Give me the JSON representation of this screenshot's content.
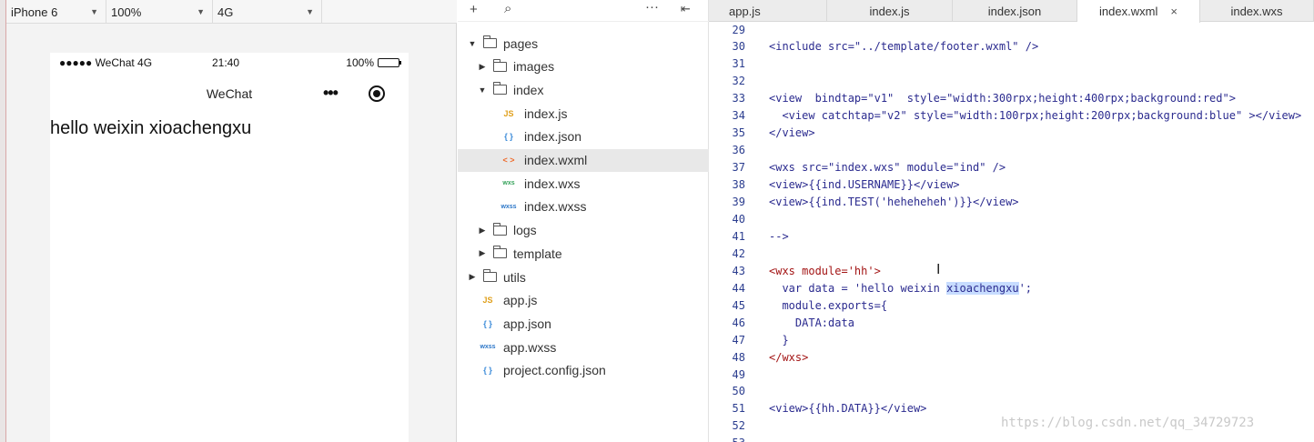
{
  "simulator": {
    "device": "iPhone 6",
    "zoom": "100%",
    "network": "4G",
    "status": {
      "carrier": "●●●●● WeChat 4G",
      "time": "21:40",
      "battery": "100%",
      "battery_level": 1.0
    },
    "nav_title": "WeChat",
    "nav_more": "•••",
    "page_text": "hello weixin xioachengxu"
  },
  "explorer": {
    "tree": [
      {
        "label": "pages",
        "type": "folder",
        "expanded": true,
        "depth": 0
      },
      {
        "label": "images",
        "type": "folder",
        "expanded": false,
        "depth": 1
      },
      {
        "label": "index",
        "type": "folder",
        "expanded": true,
        "depth": 1
      },
      {
        "label": "index.js",
        "type": "js",
        "icon_text": "JS",
        "depth": 2
      },
      {
        "label": "index.json",
        "type": "json",
        "icon_text": "{ }",
        "depth": 2
      },
      {
        "label": "index.wxml",
        "type": "wxml",
        "icon_text": "< >",
        "depth": 2,
        "selected": true
      },
      {
        "label": "index.wxs",
        "type": "wxs",
        "icon_text": "wxs",
        "depth": 2
      },
      {
        "label": "index.wxss",
        "type": "wxss",
        "icon_text": "wxss",
        "depth": 2
      },
      {
        "label": "logs",
        "type": "folder",
        "expanded": false,
        "depth": 1
      },
      {
        "label": "template",
        "type": "folder",
        "expanded": false,
        "depth": 1
      },
      {
        "label": "utils",
        "type": "folder",
        "expanded": false,
        "depth": 0
      },
      {
        "label": "app.js",
        "type": "js",
        "icon_text": "JS",
        "depth": 0
      },
      {
        "label": "app.json",
        "type": "json",
        "icon_text": "{ }",
        "depth": 0
      },
      {
        "label": "app.wxss",
        "type": "wxss",
        "icon_text": "wxss",
        "depth": 0
      },
      {
        "label": "project.config.json",
        "type": "json",
        "icon_text": "{ }",
        "depth": 0
      }
    ]
  },
  "editor": {
    "tabs": [
      {
        "label": "app.js",
        "active": false
      },
      {
        "label": "index.js",
        "active": false
      },
      {
        "label": "index.json",
        "active": false
      },
      {
        "label": "index.wxml",
        "active": true,
        "close": "×"
      },
      {
        "label": "index.wxs",
        "active": false
      }
    ],
    "lines": [
      {
        "n": "29",
        "text": ""
      },
      {
        "n": "30",
        "text": "<include src=\"../template/footer.wxml\" />"
      },
      {
        "n": "31",
        "text": ""
      },
      {
        "n": "32",
        "text": ""
      },
      {
        "n": "33",
        "text": "<view  bindtap=\"v1\"  style=\"width:300rpx;height:400rpx;background:red\">"
      },
      {
        "n": "34",
        "text": "  <view catchtap=\"v2\" style=\"width:100rpx;height:200rpx;background:blue\" ></view>"
      },
      {
        "n": "35",
        "text": "</view>"
      },
      {
        "n": "36",
        "text": ""
      },
      {
        "n": "37",
        "text": "<wxs src=\"index.wxs\" module=\"ind\" />"
      },
      {
        "n": "38",
        "text": "<view>{{ind.USERNAME}}</view>"
      },
      {
        "n": "39",
        "text": "<view>{{ind.TEST('heheheheh')}}</view>"
      },
      {
        "n": "40",
        "text": ""
      },
      {
        "n": "41",
        "text": "-->"
      },
      {
        "n": "42",
        "text": ""
      },
      {
        "n": "43",
        "text": "<wxs module='hh'>",
        "wxs": true
      },
      {
        "n": "44",
        "pre": "  var data = 'hello weixin ",
        "hl": "xioachengxu",
        "post": "';"
      },
      {
        "n": "45",
        "text": "  module.exports={"
      },
      {
        "n": "46",
        "text": "    DATA:data"
      },
      {
        "n": "47",
        "text": "  }"
      },
      {
        "n": "48",
        "text": "</wxs>",
        "wxs": true
      },
      {
        "n": "49",
        "text": ""
      },
      {
        "n": "50",
        "text": ""
      },
      {
        "n": "51",
        "text": "<view>{{hh.DATA}}</view>"
      },
      {
        "n": "52",
        "text": ""
      },
      {
        "n": "53",
        "text": ""
      }
    ],
    "watermark": "https://blog.csdn.net/qq_34729723"
  }
}
